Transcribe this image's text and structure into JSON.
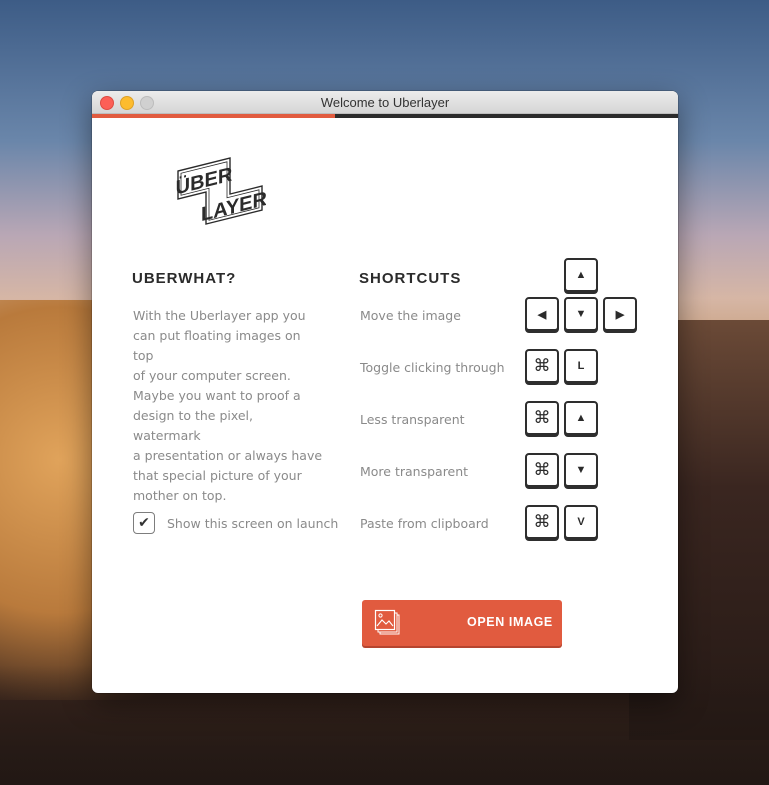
{
  "window": {
    "title": "Welcome to Uberlayer"
  },
  "progress": {
    "fraction": 0.415
  },
  "colors": {
    "accent": "#e15b3f",
    "dark": "#2b2b2b",
    "muted": "#8a8a8a"
  },
  "logo": {
    "line1": "ÜBER",
    "line2": "LAYER"
  },
  "about": {
    "heading": "UBERWHAT?",
    "paragraph1": [
      "With the Uberlayer app you",
      "can put floating images on top",
      "of your computer screen."
    ],
    "paragraph2": [
      "Maybe you want to proof a",
      "design to the pixel, watermark",
      "a presentation or always have",
      "that special picture of your",
      "mother on top."
    ],
    "show_on_launch_label": "Show this screen on launch",
    "show_on_launch_checked": true,
    "check_glyph": "✔"
  },
  "shortcuts": {
    "heading": "SHORTCUTS",
    "items": [
      {
        "label": "Move the image",
        "keys": [
          "◀",
          "▼",
          "▶"
        ],
        "extra_key": "▲"
      },
      {
        "label": "Toggle clicking through",
        "keys": [
          "⌘",
          "L"
        ]
      },
      {
        "label": "Less transparent",
        "keys": [
          "⌘",
          "▲"
        ]
      },
      {
        "label": "More transparent",
        "keys": [
          "⌘",
          "▼"
        ]
      },
      {
        "label": "Paste from clipboard",
        "keys": [
          "⌘",
          "V"
        ]
      }
    ]
  },
  "open_button": {
    "label": "OPEN IMAGE",
    "icon": "image-stack-icon"
  }
}
